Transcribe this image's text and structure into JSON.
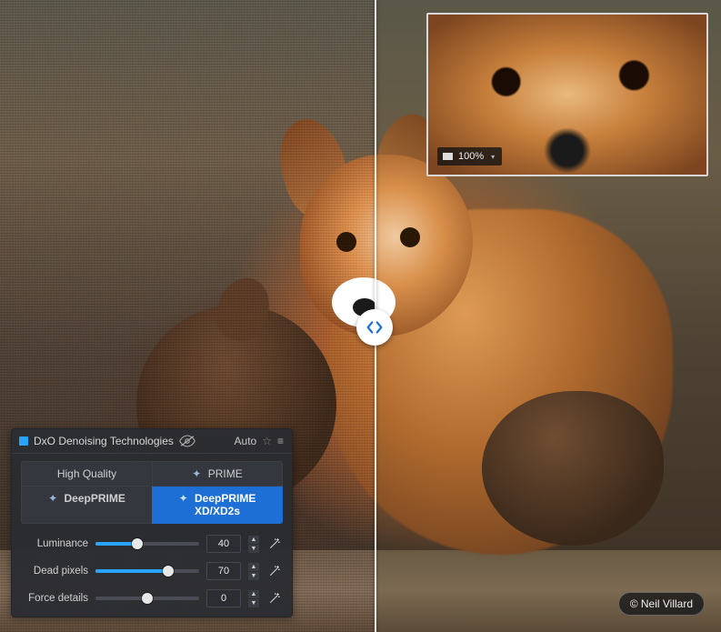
{
  "panel": {
    "title": "DxO Denoising Technologies",
    "auto_label": "Auto",
    "tabs": {
      "hq": "High Quality",
      "prime": "PRIME",
      "deep": "DeepPRIME",
      "deepxd": "DeepPRIME XD/XD2s"
    },
    "sliders": {
      "luminance": {
        "label": "Luminance",
        "value": 40,
        "min": 0,
        "max": 100
      },
      "dead_pixels": {
        "label": "Dead pixels",
        "value": 70,
        "min": 0,
        "max": 100
      },
      "force_details": {
        "label": "Force details",
        "value": 0,
        "min": -100,
        "max": 100
      }
    }
  },
  "inset": {
    "zoom_label": "100%"
  },
  "credit": {
    "text": "© Neil Villard"
  }
}
